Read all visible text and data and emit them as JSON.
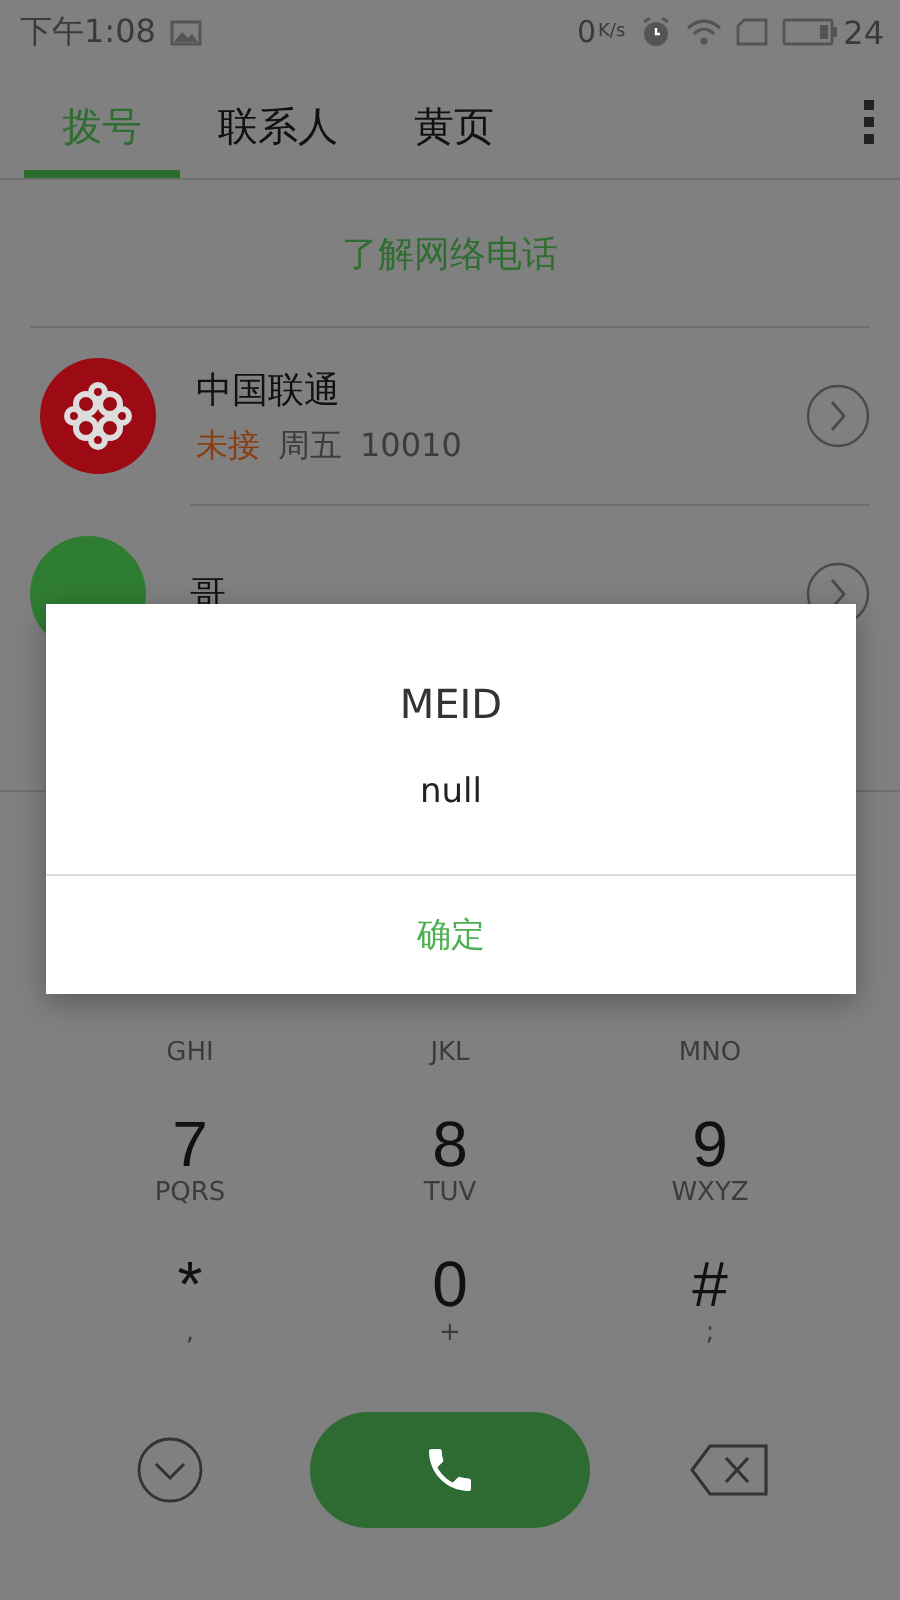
{
  "status_bar": {
    "time": "下午1:08",
    "speed_value": "0",
    "speed_unit": "K/s",
    "battery": "24"
  },
  "tabs": [
    {
      "label": "拨号",
      "selected": true
    },
    {
      "label": "联系人",
      "selected": false
    },
    {
      "label": "黄页",
      "selected": false
    }
  ],
  "link": "了解网络电话",
  "calls": [
    {
      "name": "中国联通",
      "avatar": {
        "kind": "logo",
        "color": "#9c0a14"
      },
      "missed": true,
      "call_type": "未接",
      "day": "周五",
      "number": "10010"
    },
    {
      "name": "哥",
      "avatar": {
        "kind": "letter",
        "color": "#2f7d32"
      }
    }
  ],
  "keys": [
    {
      "letters": "GHI"
    },
    {
      "letters": "JKL"
    },
    {
      "letters": "MNO"
    },
    {
      "digit": "7",
      "letters": "PQRS"
    },
    {
      "digit": "8",
      "letters": "TUV"
    },
    {
      "digit": "9",
      "letters": "WXYZ"
    },
    {
      "digit": "*",
      "letters": ","
    },
    {
      "digit": "0",
      "letters": "+"
    },
    {
      "digit": "#",
      "letters": ";"
    }
  ],
  "dialog": {
    "title": "MEID",
    "message": "null",
    "button": "确定"
  }
}
